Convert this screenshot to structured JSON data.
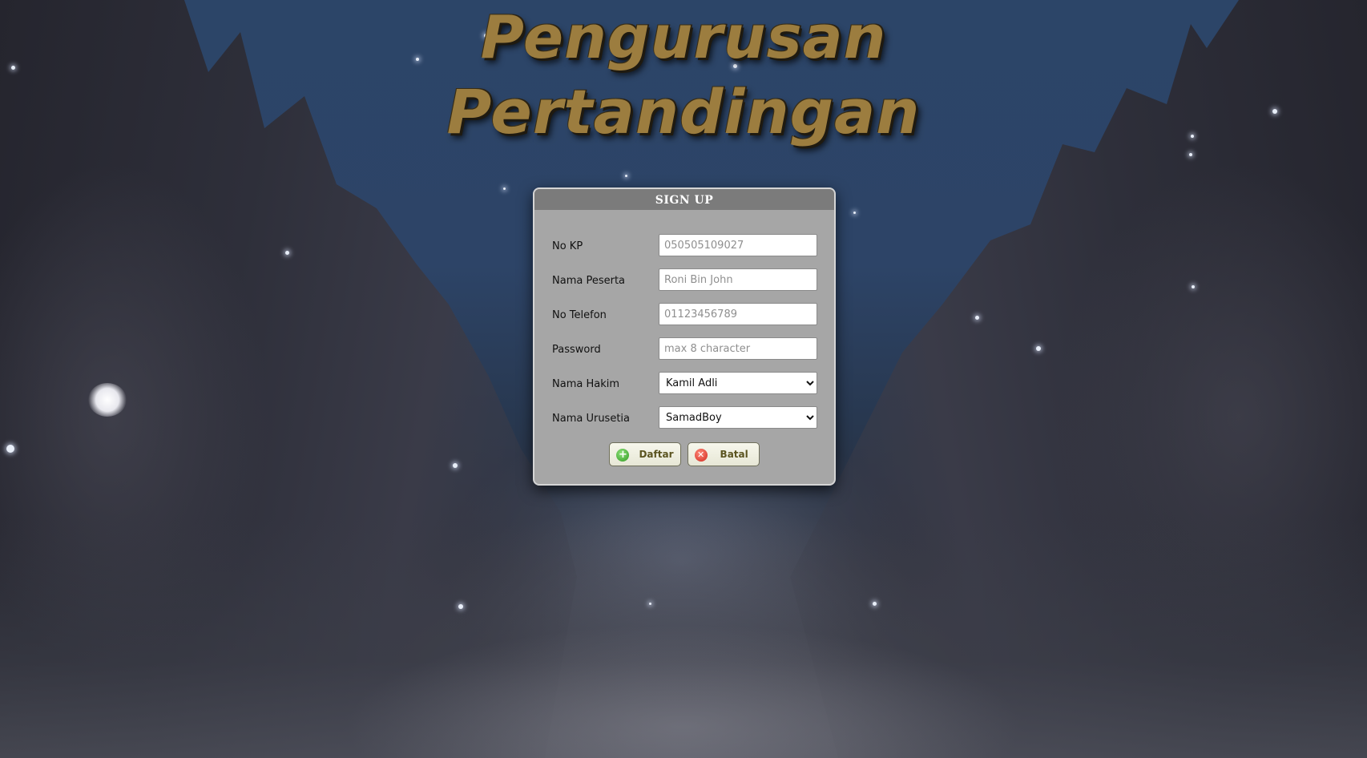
{
  "page": {
    "title_line1": "Pengurusan",
    "title_line2": "Pertandingan"
  },
  "signup": {
    "header": "SIGN UP",
    "fields": [
      {
        "label": "No KP",
        "placeholder": "050505109027"
      },
      {
        "label": "Nama Peserta",
        "placeholder": "Roni Bin John"
      },
      {
        "label": "No Telefon",
        "placeholder": "01123456789"
      },
      {
        "label": "Password",
        "placeholder": "max 8 character"
      }
    ],
    "hakim": {
      "label": "Nama Hakim",
      "selected": "Kamil Adli"
    },
    "urusetia": {
      "label": "Nama Urusetia",
      "selected": "SamadBoy"
    },
    "buttons": {
      "submit_label": "Daftar",
      "submit_icon": "plus-circle-icon",
      "cancel_label": "Batal",
      "cancel_icon": "close-circle-icon"
    }
  },
  "colors": {
    "title": "#9c7d3f",
    "panel_bg": "#a6a6a6",
    "panel_header": "#7b7b7b",
    "submit_icon": "#2f9a22",
    "cancel_icon": "#d0261b"
  }
}
